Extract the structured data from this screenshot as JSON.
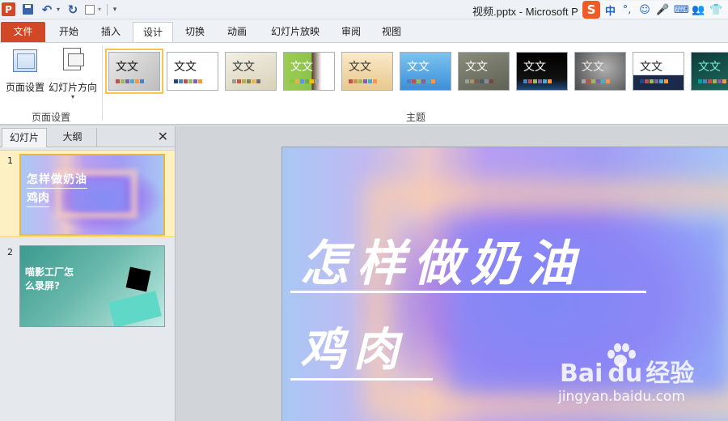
{
  "window": {
    "title": "视频.pptx - Microsoft P",
    "app_logo": "P",
    "ime": {
      "brand": "S",
      "lang": "中",
      "punct": "°,",
      "emoji": "☺",
      "voice": "🎤",
      "keyboard": "⌨",
      "user": "👥",
      "skin": "👕"
    }
  },
  "quick_access": {
    "undo_glyph": "↶",
    "redo_glyph": "↻",
    "dropdown_glyph": "▾",
    "customize_glyph": "▾"
  },
  "ribbon": {
    "tabs": [
      {
        "label": "文件"
      },
      {
        "label": "开始"
      },
      {
        "label": "插入"
      },
      {
        "label": "设计"
      },
      {
        "label": "切换"
      },
      {
        "label": "动画"
      },
      {
        "label": "幻灯片放映"
      },
      {
        "label": "审阅"
      },
      {
        "label": "视图"
      }
    ],
    "active_tab": "设计",
    "page_setup_group": {
      "label": "页面设置",
      "page_setup_button": "页面设置",
      "orientation_button": "幻灯片方向",
      "orientation_arrow": "▾"
    },
    "themes_group": {
      "label": "主题",
      "sample_text": "文文",
      "themes": [
        {
          "bg": "linear-gradient(135deg,#e9e9e9,#bdbdbd)",
          "fg": "#111",
          "selected": true,
          "swatches": [
            "#c0504d",
            "#9bbb59",
            "#8064a2",
            "#4bacc6",
            "#f79646",
            "#4f81bd"
          ]
        },
        {
          "bg": "#ffffff",
          "fg": "#111",
          "selected": false,
          "swatches": [
            "#1f497d",
            "#4f81bd",
            "#c0504d",
            "#9bbb59",
            "#8064a2",
            "#f79646"
          ]
        },
        {
          "bg": "linear-gradient(160deg,#f3f0e4,#d8d2b8)",
          "fg": "#333",
          "selected": false,
          "swatches": [
            "#93a299",
            "#cf543f",
            "#b5ae53",
            "#848058",
            "#e8b54d",
            "#786c71"
          ]
        },
        {
          "bg": "linear-gradient(90deg,#9ccc54 0%,#8bc34a 55%,#5a3e2b 56%,#fff 75%)",
          "fg": "#fff",
          "selected": false,
          "swatches": [
            "#8cc63f",
            "#f0ad4e",
            "#5b9bd5",
            "#70ad47",
            "#ffc000",
            "#a5a5a5"
          ]
        },
        {
          "bg": "linear-gradient(180deg,#fbe9c8,#e8c98f)",
          "fg": "#333",
          "selected": false,
          "swatches": [
            "#c0504d",
            "#d19049",
            "#9bbb59",
            "#8064a2",
            "#4bacc6",
            "#f79646"
          ]
        },
        {
          "bg": "linear-gradient(180deg,#7cc4ef,#3c8fd9)",
          "fg": "#fff",
          "selected": false,
          "swatches": [
            "#4f81bd",
            "#c0504d",
            "#9bbb59",
            "#8064a2",
            "#4bacc6",
            "#f79646"
          ]
        },
        {
          "bg": "linear-gradient(160deg,#8a8c7b,#5f6154)",
          "fg": "#fff",
          "selected": false,
          "swatches": [
            "#93a299",
            "#ad8f67",
            "#726056",
            "#4c5a6a",
            "#808da0",
            "#79463d"
          ]
        },
        {
          "bg": "linear-gradient(180deg,#000 0%,#111 70%,#1b4a7a 100%)",
          "fg": "#fff",
          "selected": false,
          "swatches": [
            "#4f81bd",
            "#c0504d",
            "#9bbb59",
            "#8064a2",
            "#4bacc6",
            "#f79646"
          ]
        },
        {
          "bg": "radial-gradient(circle at 60% 40%,#b0b0b0,#4a4a4a)",
          "fg": "#eee",
          "selected": false,
          "swatches": [
            "#a5a5a5",
            "#c0504d",
            "#9bbb59",
            "#8064a2",
            "#4bacc6",
            "#f79646"
          ]
        },
        {
          "bg": "linear-gradient(180deg,#fff 0%,#fff 60%,#1c2a4a 61%)",
          "fg": "#222",
          "selected": false,
          "swatches": [
            "#1f497d",
            "#c0504d",
            "#9bbb59",
            "#8064a2",
            "#4bacc6",
            "#f79646"
          ]
        },
        {
          "bg": "linear-gradient(160deg,#0f3b3a,#1e6b5f)",
          "fg": "#7ef2d6",
          "selected": false,
          "swatches": [
            "#00a3a0",
            "#4f81bd",
            "#c0504d",
            "#9bbb59",
            "#8064a2",
            "#f79646"
          ]
        }
      ]
    }
  },
  "left_pane": {
    "tabs": [
      "幻灯片",
      "大纲"
    ],
    "close_glyph": "✕",
    "slides": [
      {
        "number": "1",
        "title_line1": "怎样做奶油",
        "title_line2": "鸡肉"
      },
      {
        "number": "2",
        "title_line1": "喵影工厂怎",
        "title_line2": "么录屏?"
      }
    ]
  },
  "editor": {
    "slide_title_line1": "怎样做奶油",
    "slide_title_line2": "鸡肉"
  },
  "watermark": {
    "logo_left": "Bai",
    "logo_right": "du",
    "logo_cn": "经验",
    "url": "jingyan.baidu.com"
  }
}
